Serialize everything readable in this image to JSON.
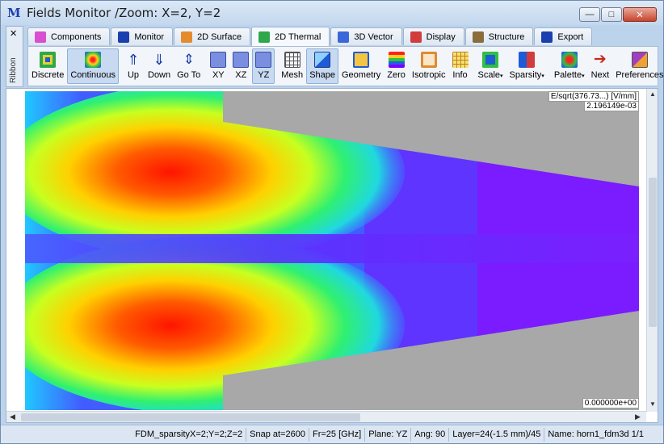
{
  "window": {
    "title": "Fields Monitor /Zoom: X=2, Y=2",
    "app_icon_letter": "M",
    "min_glyph": "—",
    "max_glyph": "□",
    "close_glyph": "✕"
  },
  "ribbon": {
    "side_label": "Ribbon",
    "close_glyph": "✕"
  },
  "tabs": [
    {
      "label": "Components",
      "icon": "components-icon",
      "color": "#d94fd0",
      "active": false
    },
    {
      "label": "Monitor",
      "icon": "monitor-icon",
      "color": "#1b3fae",
      "active": false
    },
    {
      "label": "2D Surface",
      "icon": "2d-surface-icon",
      "color": "#e58b2e",
      "active": false
    },
    {
      "label": "2D Thermal",
      "icon": "2d-thermal-icon",
      "color": "#2ea84a",
      "active": true
    },
    {
      "label": "3D Vector",
      "icon": "3d-vector-icon",
      "color": "#3a68d8",
      "active": false
    },
    {
      "label": "Display",
      "icon": "display-icon",
      "color": "#d23c3c",
      "active": false
    },
    {
      "label": "Structure",
      "icon": "structure-icon",
      "color": "#8a6d3b",
      "active": false
    },
    {
      "label": "Export",
      "icon": "export-icon",
      "color": "#1b3fae",
      "active": false
    }
  ],
  "toolbar": {
    "discrete": "Discrete",
    "continuous": "Continuous",
    "up": "Up",
    "down": "Down",
    "goto": "Go To",
    "xy": "XY",
    "xz": "XZ",
    "yz": "YZ",
    "mesh": "Mesh",
    "shape": "Shape",
    "geometry": "Geometry",
    "zero": "Zero",
    "isotropic": "Isotropic",
    "info": "Info",
    "scale": "Scale",
    "sparsity": "Sparsity",
    "palette": "Palette",
    "next": "Next",
    "preferences": "Preferences",
    "caret": "▾"
  },
  "plot": {
    "colorbar_title": "E/sqrt(376.73...) [V/mm]",
    "colorbar_max": "2.196149e-03",
    "colorbar_min": "0.000000e+00"
  },
  "statusbar": {
    "sparsity": "FDM_sparsityX=2;Y=2;Z=2",
    "snap": "Snap at=2600",
    "freq": "Fr=25 [GHz]",
    "plane": "Plane: YZ",
    "angle": "Ang:  90",
    "layer": "Layer=24(-1.5 mm)/45",
    "name": "Name: horn1_fdm3d 1/1"
  }
}
